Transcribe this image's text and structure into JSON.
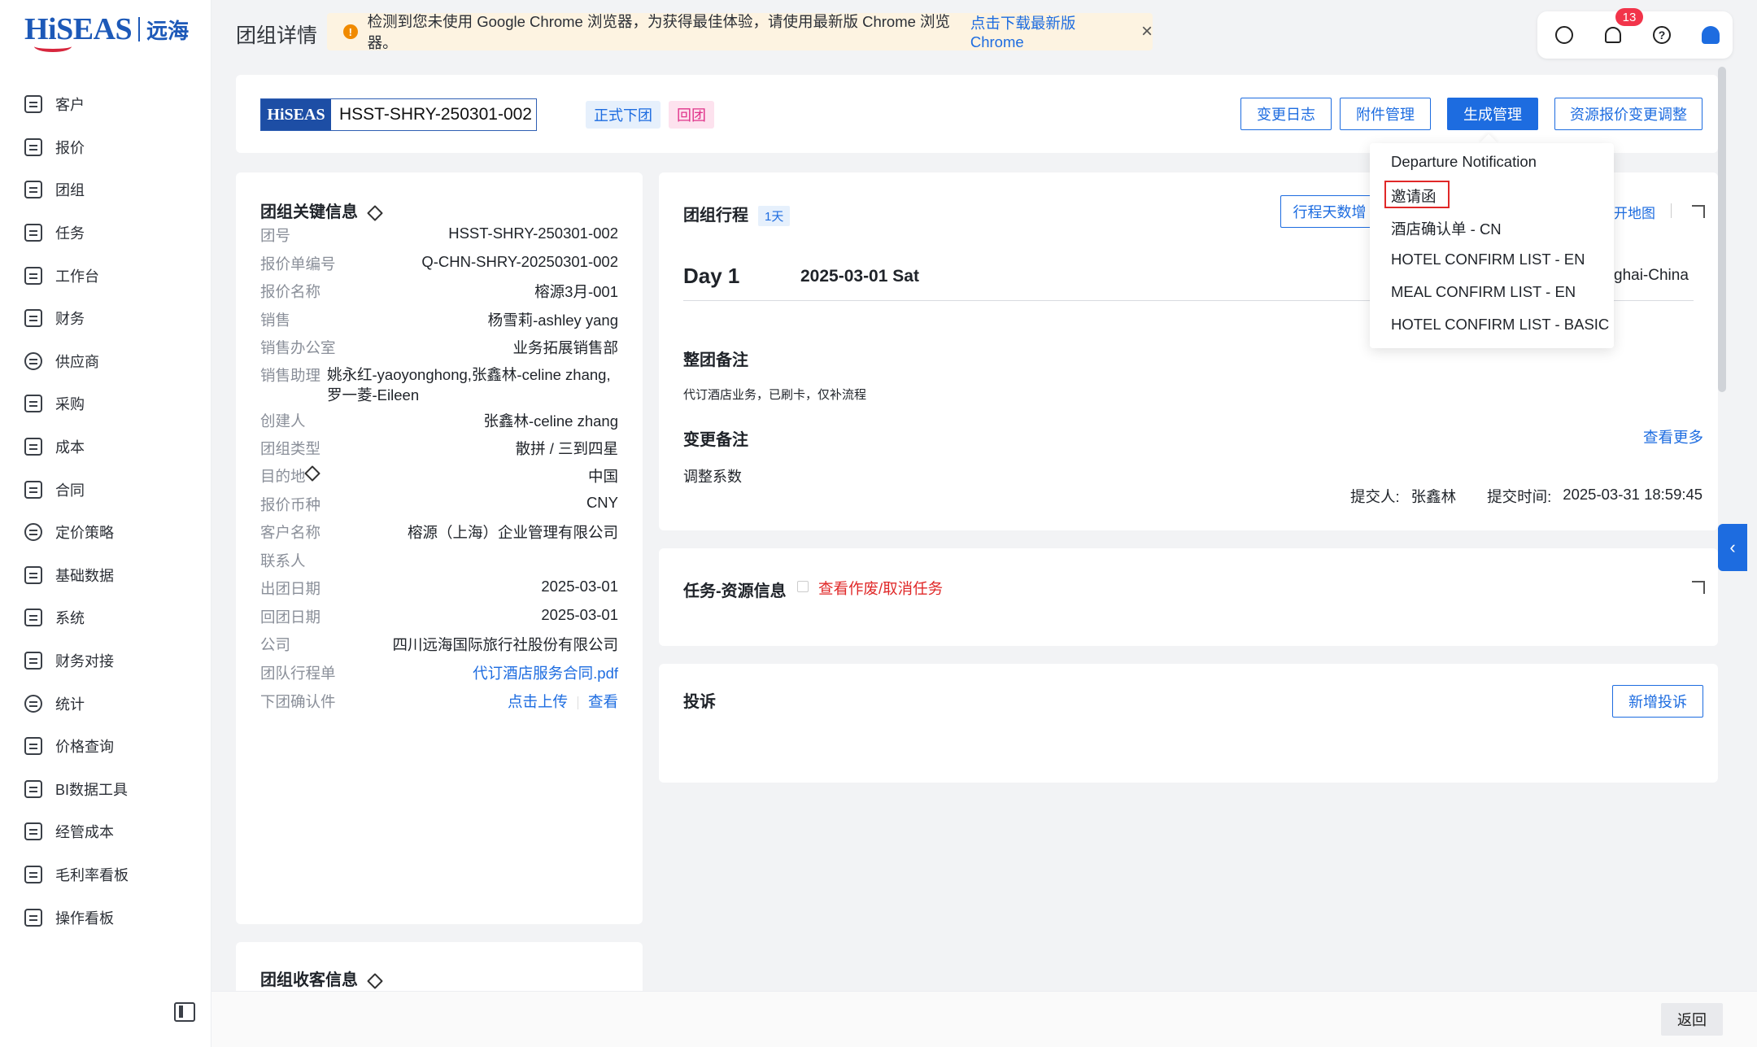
{
  "sidebar": {
    "logo_en": "HiSEAS",
    "logo_cn": "远海",
    "items": [
      {
        "label": "客户",
        "icon": "user-card-icon"
      },
      {
        "label": "报价",
        "icon": "quote-icon"
      },
      {
        "label": "团组",
        "icon": "group-icon"
      },
      {
        "label": "任务",
        "icon": "task-icon"
      },
      {
        "label": "工作台",
        "icon": "workbench-icon"
      },
      {
        "label": "财务",
        "icon": "finance-icon"
      },
      {
        "label": "供应商",
        "icon": "supplier-icon"
      },
      {
        "label": "采购",
        "icon": "purchase-icon"
      },
      {
        "label": "成本",
        "icon": "cost-icon"
      },
      {
        "label": "合同",
        "icon": "contract-icon"
      },
      {
        "label": "定价策略",
        "icon": "pricing-icon"
      },
      {
        "label": "基础数据",
        "icon": "database-icon"
      },
      {
        "label": "系统",
        "icon": "system-icon"
      },
      {
        "label": "财务对接",
        "icon": "finance-link-icon"
      },
      {
        "label": "统计",
        "icon": "stats-icon"
      },
      {
        "label": "价格查询",
        "icon": "price-search-icon"
      },
      {
        "label": "BI数据工具",
        "icon": "bi-icon"
      },
      {
        "label": "经管成本",
        "icon": "management-cost-icon"
      },
      {
        "label": "毛利率看板",
        "icon": "margin-board-icon"
      },
      {
        "label": "操作看板",
        "icon": "operation-board-icon"
      }
    ]
  },
  "header": {
    "title": "团组详情",
    "banner_text": "检测到您未使用 Google Chrome 浏览器，为获得最佳体验，请使用最新版 Chrome 浏览器。",
    "banner_link": "点击下载最新版 Chrome",
    "banner_close": "×",
    "notification_count": "13",
    "help_glyph": "?"
  },
  "top_card": {
    "logo": "HiSEAS",
    "group_no": "HSST-SHRY-250301-002",
    "tag_status": "正式下团",
    "tag_return": "回团",
    "buttons": {
      "change_log": "变更日志",
      "attachments": "附件管理",
      "generate": "生成管理",
      "resource_adjust": "资源报价变更调整"
    }
  },
  "key_info": {
    "title": "团组关键信息",
    "rows": [
      {
        "label": "团号",
        "value": "HSST-SHRY-250301-002"
      },
      {
        "label": "报价单编号",
        "value": "Q-CHN-SHRY-20250301-002"
      },
      {
        "label": "报价名称",
        "value": "榕源3月-001"
      },
      {
        "label": "销售",
        "value": "杨雪莉-ashley yang"
      },
      {
        "label": "销售办公室",
        "value": "业务拓展销售部"
      },
      {
        "label": "销售助理",
        "value": "姚永红-yaoyonghong,张鑫林-celine zhang,罗一菱-Eileen"
      },
      {
        "label": "创建人",
        "value": "张鑫林-celine zhang"
      },
      {
        "label": "团组类型",
        "value": "散拼 / 三到四星"
      },
      {
        "label": "目的地",
        "value": "中国"
      },
      {
        "label": "报价币种",
        "value": "CNY"
      },
      {
        "label": "客户名称",
        "value": "榕源（上海）企业管理有限公司"
      },
      {
        "label": "联系人",
        "value": ""
      },
      {
        "label": "出团日期",
        "value": "2025-03-01"
      },
      {
        "label": "回团日期",
        "value": "2025-03-01"
      },
      {
        "label": "公司",
        "value": "四川远海国际旅行社股份有限公司"
      },
      {
        "label": "团队行程单",
        "value": "代订酒店服务合同.pdf"
      },
      {
        "label": "下团确认件",
        "value": ""
      }
    ],
    "upload_label": "点击上传",
    "view_label": "查看"
  },
  "receivable": {
    "title": "团组收客信息"
  },
  "itinerary": {
    "title": "团组行程",
    "days_tag": "1天",
    "add_days_btn": "行程天数增",
    "map_link": "开地图",
    "day_label": "Day 1",
    "day_date": "2025-03-01 Sat",
    "day_city": "ghai-China",
    "group_note_title": "整团备注",
    "group_note": "代订酒店业务，已刷卡，仅补流程",
    "change_note_title": "变更备注",
    "see_more": "查看更多",
    "change_note": "调整系数",
    "submitter_label": "提交人:",
    "submitter": "张鑫林",
    "submit_time_label": "提交时间:",
    "submit_time": "2025-03-31 18:59:45"
  },
  "task_resource": {
    "title": "任务-资源信息",
    "void_link": "查看作废/取消任务"
  },
  "complaint": {
    "title": "投诉",
    "add_btn": "新增投诉"
  },
  "dropdown": {
    "items": [
      "Departure Notification",
      "邀请函",
      "酒店确认单 - CN",
      "HOTEL CONFIRM LIST - EN",
      "MEAL CONFIRM LIST - EN",
      "HOTEL CONFIRM LIST - BASIC"
    ]
  },
  "footer": {
    "back": "返回"
  },
  "colors": {
    "primary": "#1d6ce0",
    "warning": "#f08a00",
    "danger": "#e02828",
    "pink_tag": "#e0338a"
  }
}
